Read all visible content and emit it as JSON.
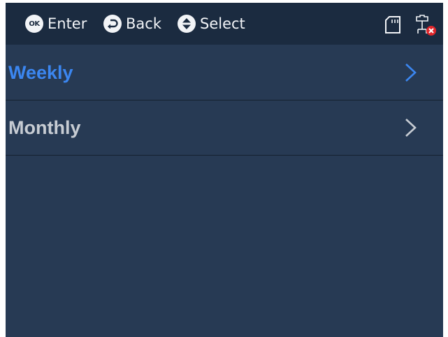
{
  "header": {
    "hints": [
      {
        "key": "OK",
        "label": "Enter",
        "icon": "ok-button-icon"
      },
      {
        "key": "back",
        "label": "Back",
        "icon": "back-arrow-icon"
      },
      {
        "key": "updown",
        "label": "Select",
        "icon": "up-down-icon"
      }
    ],
    "status_icons": [
      "sd-card-icon",
      "network-disconnected-icon"
    ]
  },
  "menu": {
    "items": [
      {
        "label": "Weekly",
        "selected": true
      },
      {
        "label": "Monthly",
        "selected": false
      }
    ]
  },
  "colors": {
    "background": "#273a54",
    "header": "#1b2b40",
    "selected_text": "#3b86f0",
    "normal_text": "#c7ccd3",
    "error_red": "#e0262b"
  }
}
